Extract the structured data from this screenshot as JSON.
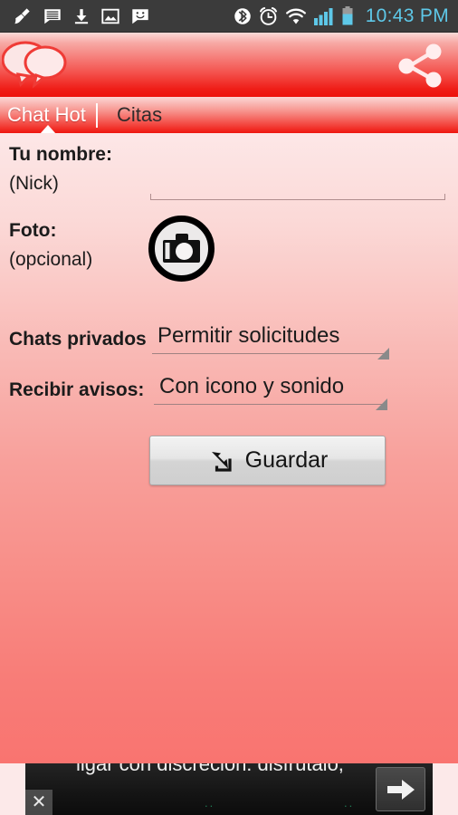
{
  "status_bar": {
    "time": "10:43 PM",
    "left_icons": [
      "broom-cleaner-icon",
      "message-lines-icon",
      "download-icon",
      "photo-icon",
      "smiley-chat-icon"
    ],
    "right_icons": [
      "bluetooth-icon",
      "alarm-clock-icon",
      "wifi-icon",
      "signal-bars-icon",
      "battery-icon"
    ],
    "colors": {
      "background": "#3b3b3b",
      "accent": "#5ec8e8",
      "icon": "#ffffff"
    }
  },
  "header": {
    "logo_name": "chat-bubbles-logo",
    "share_icon": "share-icon",
    "gradient_top": "#fbdad8",
    "gradient_bottom": "#ed120c"
  },
  "tabs": [
    {
      "label": "Chat Hot",
      "active": true
    },
    {
      "label": "Citas",
      "active": false
    }
  ],
  "form": {
    "name": {
      "label": "Tu nombre:",
      "sublabel": "(Nick)",
      "value": "",
      "placeholder": ""
    },
    "photo": {
      "label": "Foto:",
      "sublabel": "(opcional)",
      "button_icon": "camera-icon"
    },
    "private_chats": {
      "label": "Chats privados",
      "value": "Permitir solicitudes",
      "options": [
        "Permitir solicitudes"
      ]
    },
    "notifications": {
      "label": "Recibir avisos:",
      "value": "Con icono y sonido",
      "options": [
        "Con icono y sonido"
      ]
    },
    "save": {
      "label": "Guardar",
      "icon": "save-arrow-icon"
    }
  },
  "ad_banner": {
    "text": "ligar con discreción: disfrútalo,",
    "sub_left": "..",
    "sub_right": "..",
    "cta_icon": "arrow-right-icon",
    "close_icon": "close-icon"
  },
  "theme": {
    "page_gradient_top": "#fde7e7",
    "page_gradient_bottom": "#f97470",
    "text": "#1b1b1b",
    "brand_red": "#ed120c"
  }
}
